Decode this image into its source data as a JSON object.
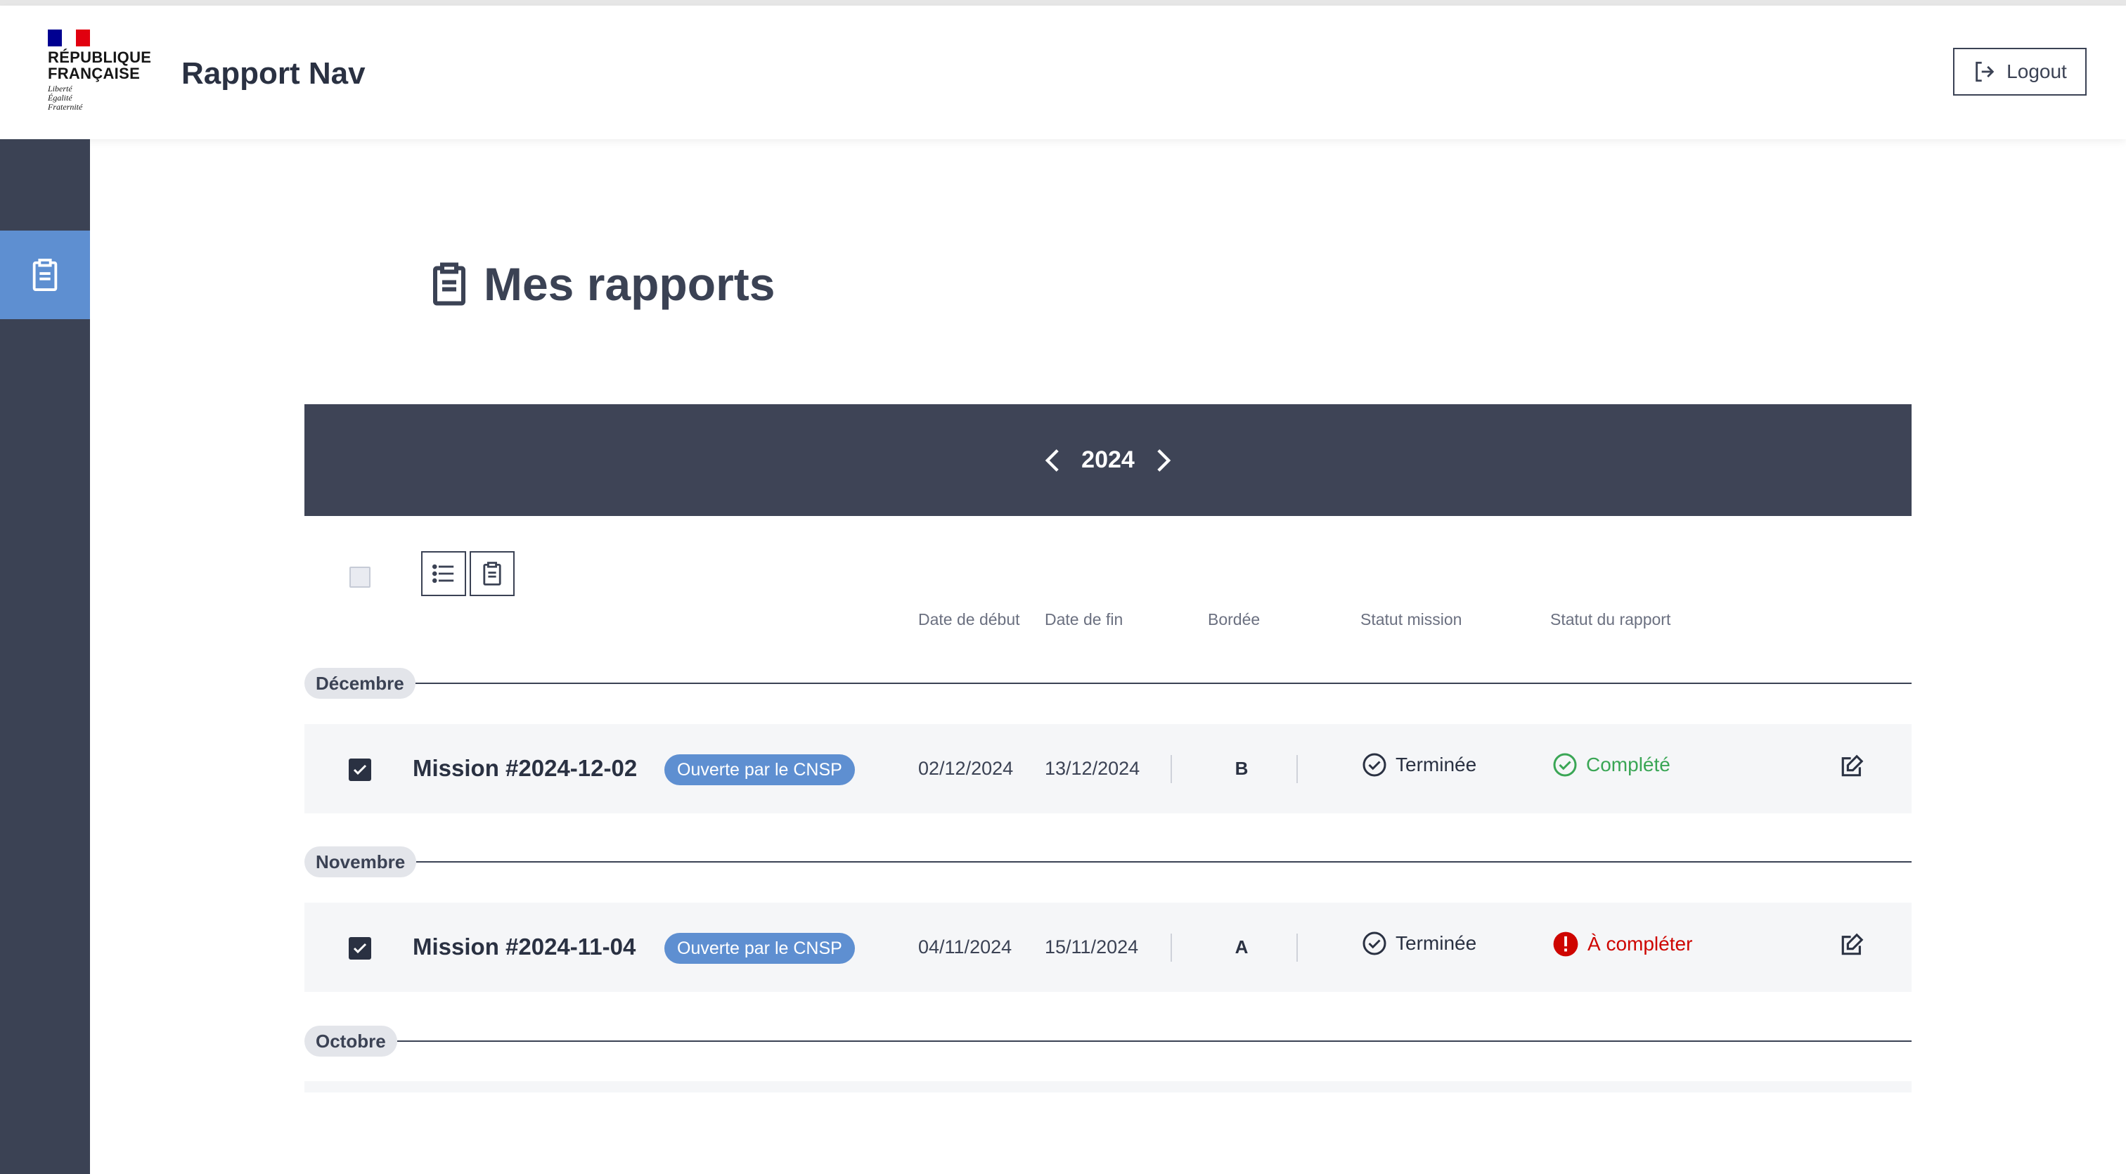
{
  "header": {
    "logo": {
      "lines": [
        "RÉPUBLIQUE",
        "FRANÇAISE"
      ],
      "motto": [
        "Liberté",
        "Égalité",
        "Fraternité"
      ]
    },
    "app_title": "Rapport Nav",
    "logout_label": "Logout"
  },
  "sidebar": {
    "items": [
      {
        "icon": "clipboard-icon",
        "active": true
      }
    ]
  },
  "page": {
    "title": "Mes rapports"
  },
  "year_selector": {
    "year": "2024"
  },
  "toolbar": {
    "views": [
      "list-view",
      "report-view"
    ]
  },
  "columns": {
    "start_date": "Date de début",
    "end_date": "Date de fin",
    "bordee": "Bordée",
    "mission_status": "Statut mission",
    "report_status": "Statut du rapport"
  },
  "groups": [
    {
      "month": "Décembre",
      "missions": [
        {
          "name": "Mission #2024-12-02",
          "tag": "Ouverte par le CNSP",
          "start": "02/12/2024",
          "end": "13/12/2024",
          "bordee": "B",
          "mission_status": "Terminée",
          "report_status": "Complété",
          "report_status_color": "#3aa655",
          "checked": true
        }
      ]
    },
    {
      "month": "Novembre",
      "missions": [
        {
          "name": "Mission #2024-11-04",
          "tag": "Ouverte par le CNSP",
          "start": "04/11/2024",
          "end": "15/11/2024",
          "bordee": "A",
          "mission_status": "Terminée",
          "report_status": "À compléter",
          "report_status_color": "#ce0500",
          "checked": true
        }
      ]
    },
    {
      "month": "Octobre",
      "missions": []
    }
  ],
  "colors": {
    "sidebar": "#3b4254",
    "accent": "#5e8fd1",
    "year_bar": "#3e4456",
    "complete": "#3aa655",
    "incomplete": "#ce0500"
  }
}
